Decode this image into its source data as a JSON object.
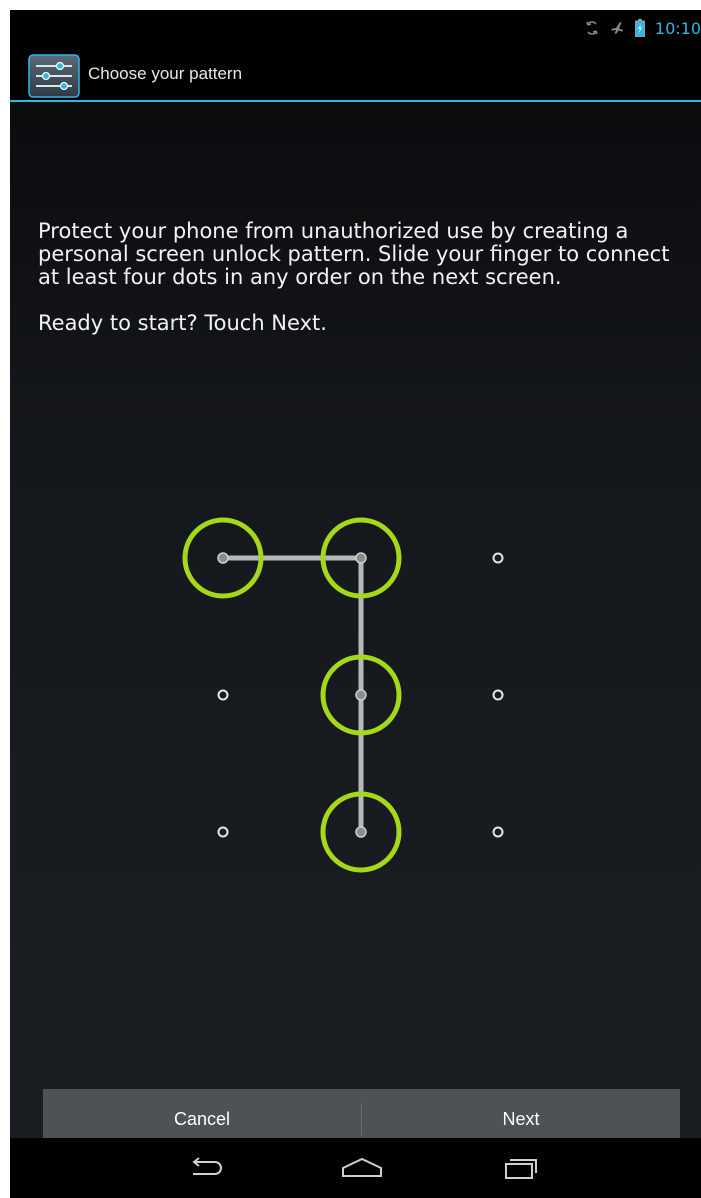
{
  "status_bar": {
    "time": "10:10",
    "icons": [
      "sync-icon",
      "airplane-mode-icon",
      "battery-icon"
    ]
  },
  "action_bar": {
    "title": "Choose your pattern",
    "app_icon": "settings-sliders-icon"
  },
  "instructions": {
    "paragraph1": "Protect your phone from unauthorized use by creating a personal screen unlock pattern. Slide your finger to connect at least four dots in any order on the next screen.",
    "paragraph2": "Ready to start? Touch Next."
  },
  "pattern": {
    "grid": 3,
    "selected_sequence": [
      1,
      2,
      5,
      8
    ],
    "accent_color": "#a4d819",
    "line_color": "#b8b8b8"
  },
  "buttons": {
    "cancel_label": "Cancel",
    "next_label": "Next"
  },
  "nav_bar": {
    "icons": [
      "back-icon",
      "home-icon",
      "recent-apps-icon"
    ]
  }
}
